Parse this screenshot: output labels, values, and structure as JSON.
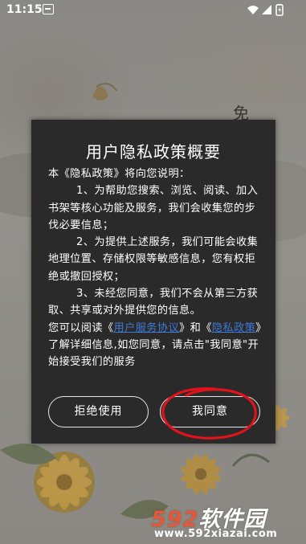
{
  "status_bar": {
    "time": "11:15",
    "icons": [
      "notification-icon",
      "wifi-icon",
      "signal-icon",
      "battery-icon"
    ]
  },
  "background": {
    "corner_char": "免"
  },
  "dialog": {
    "title": "用户隐私政策概要",
    "intro": "本《隐私政策》将向您说明：",
    "item1": "1、为帮助您搜索、浏览、阅读、加入书架等核心功能及服务，我们会收集您的步伐必要信息；",
    "item2": "2、为提供上述服务，我们可能会收集地理位置、存储权限等敏感信息，您有权拒绝或撤回授权；",
    "item3": "3、未经您同意，我们不会从第三方获取、共享或对外提供您的信息。",
    "read_prefix": "您可以阅读《",
    "link_service": "用户服务协议",
    "read_mid": "》和《",
    "link_privacy": "隐私政策",
    "read_suffix": "》了解详细信息,如您同意，请点击\"我同意\"开始接受我们的服务",
    "refuse_label": "拒绝使用",
    "agree_label": "我同意"
  },
  "watermark": {
    "num": "592",
    "name": "软件园",
    "url": "www.592xiazai.com"
  },
  "colors": {
    "dialog_bg": "#2a2a2a",
    "link": "#3f79d6",
    "annotation_circle": "#e0121b",
    "watermark_num": "#e35a3a"
  }
}
